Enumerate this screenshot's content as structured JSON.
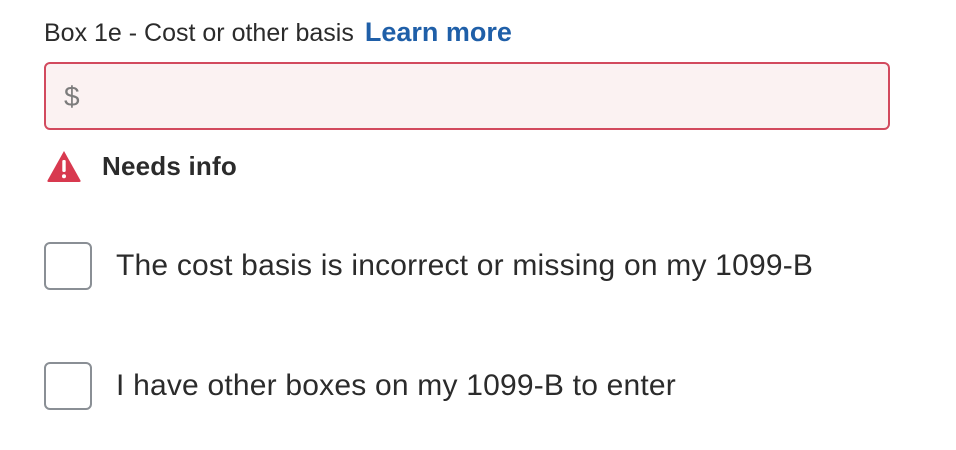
{
  "field": {
    "label": "Box 1e - Cost or other basis",
    "learn_more": "Learn more",
    "currency_symbol": "$",
    "value": "",
    "error_message": "Needs info"
  },
  "options": [
    {
      "label": "The cost basis is incorrect or missing on my 1099-B",
      "checked": false
    },
    {
      "label": "I have other boxes on my 1099-B to enter",
      "checked": false
    }
  ],
  "colors": {
    "link": "#1f5fa8",
    "error_border": "#d24a5e",
    "error_background": "#fbf2f2",
    "warning_icon": "#d8394f"
  },
  "icons": {
    "warning": "warning-triangle-icon"
  }
}
